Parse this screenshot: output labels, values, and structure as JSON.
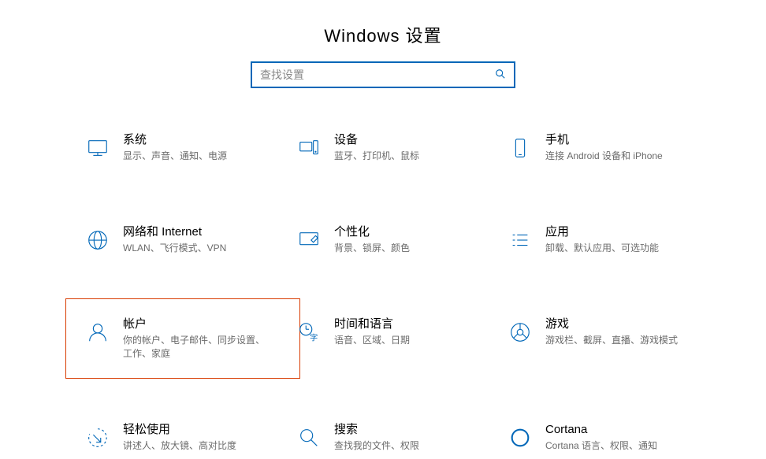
{
  "header": {
    "title": "Windows 设置"
  },
  "search": {
    "placeholder": "查找设置"
  },
  "tiles": [
    {
      "name": "system",
      "label": "系统",
      "desc": "显示、声音、通知、电源"
    },
    {
      "name": "devices",
      "label": "设备",
      "desc": "蓝牙、打印机、鼠标"
    },
    {
      "name": "phone",
      "label": "手机",
      "desc": "连接 Android 设备和 iPhone"
    },
    {
      "name": "network",
      "label": "网络和 Internet",
      "desc": "WLAN、飞行模式、VPN"
    },
    {
      "name": "personalization",
      "label": "个性化",
      "desc": "背景、锁屏、颜色"
    },
    {
      "name": "apps",
      "label": "应用",
      "desc": "卸载、默认应用、可选功能"
    },
    {
      "name": "accounts",
      "label": "帐户",
      "desc": "你的帐户、电子邮件、同步设置、工作、家庭",
      "highlight": true
    },
    {
      "name": "time-language",
      "label": "时间和语言",
      "desc": "语音、区域、日期"
    },
    {
      "name": "gaming",
      "label": "游戏",
      "desc": "游戏栏、截屏、直播、游戏模式"
    },
    {
      "name": "ease-of-access",
      "label": "轻松使用",
      "desc": "讲述人、放大镜、高对比度"
    },
    {
      "name": "search",
      "label": "搜索",
      "desc": "查找我的文件、权限"
    },
    {
      "name": "cortana",
      "label": "Cortana",
      "desc": "Cortana 语言、权限、通知"
    }
  ]
}
